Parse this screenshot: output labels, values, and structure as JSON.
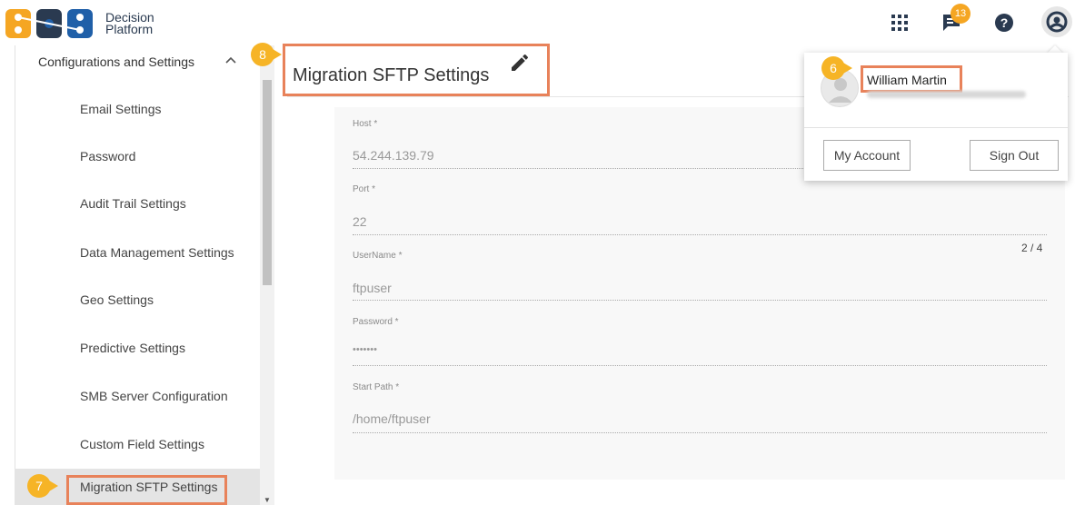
{
  "header": {
    "logo_text_line1": "Decision",
    "logo_text_line2": "Platform",
    "notification_count": "13",
    "icons": [
      "apps-grid-icon",
      "chat-icon",
      "help-icon",
      "user-account-icon"
    ]
  },
  "sidebar": {
    "group_label": "Configurations and Settings",
    "items": [
      {
        "label": "Email Settings"
      },
      {
        "label": "Password"
      },
      {
        "label": "Audit Trail Settings"
      },
      {
        "label": "Data Management Settings"
      },
      {
        "label": "Geo Settings"
      },
      {
        "label": "Predictive Settings"
      },
      {
        "label": "SMB Server Configuration"
      },
      {
        "label": "Custom Field Settings"
      },
      {
        "label": "Migration SFTP Settings",
        "active": true
      }
    ]
  },
  "main": {
    "title": "Migration SFTP Settings",
    "pager": "2 / 4",
    "fields": [
      {
        "label": "Host *",
        "value": "54.244.139.79"
      },
      {
        "label": "Port *",
        "value": "22"
      },
      {
        "label": "UserName *",
        "value": "ftpuser"
      },
      {
        "label": "Password *",
        "value": "•••••••"
      },
      {
        "label": "Start Path *",
        "value": "/home/ftpuser"
      }
    ]
  },
  "account": {
    "name": "William Martin",
    "my_account_label": "My Account",
    "sign_out_label": "Sign Out"
  },
  "callouts": {
    "six": "6",
    "seven": "7",
    "eight": "8",
    "color": "#f6b426",
    "highlight_color": "#e8825a"
  },
  "colors": {
    "brand_orange": "#f5a623",
    "brand_blue": "#1f5fa8",
    "brand_dark": "#2a3a50"
  }
}
